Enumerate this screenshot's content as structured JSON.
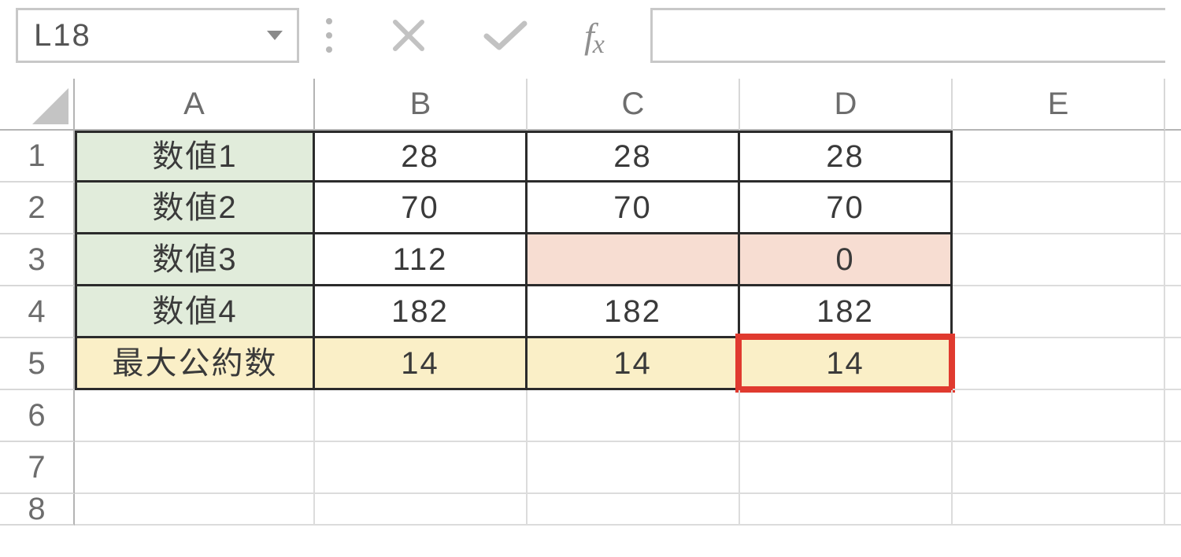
{
  "formula_bar": {
    "cell_ref": "L18",
    "formula": "",
    "cancel_icon": "cancel-icon",
    "confirm_icon": "confirm-icon",
    "fx_label": "fx"
  },
  "columns": [
    "A",
    "B",
    "C",
    "D",
    "E"
  ],
  "row_numbers": [
    "1",
    "2",
    "3",
    "4",
    "5",
    "6",
    "7",
    "8"
  ],
  "table": {
    "rows": [
      {
        "label": "数値1",
        "b": "28",
        "c": "28",
        "d": "28"
      },
      {
        "label": "数値2",
        "b": "70",
        "c": "70",
        "d": "70"
      },
      {
        "label": "数値3",
        "b": "112",
        "c": "",
        "d": "0"
      },
      {
        "label": "数値4",
        "b": "182",
        "c": "182",
        "d": "182"
      },
      {
        "label": "最大公約数",
        "b": "14",
        "c": "14",
        "d": "14"
      }
    ]
  },
  "highlight": {
    "cell": "D5"
  },
  "colors": {
    "header_green": "#e1ecdb",
    "result_yellow": "#faefc7",
    "empty_pink": "#f7ddd2",
    "annotation_red": "#e03a2f"
  }
}
